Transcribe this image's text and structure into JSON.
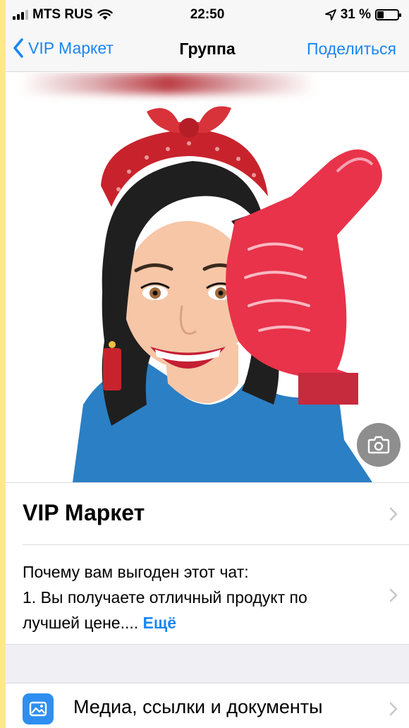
{
  "status_bar": {
    "carrier": "MTS RUS",
    "time": "22:50",
    "battery": "31 %",
    "battery_level": 0.31,
    "signal_bars": 4,
    "signal_bars_on": 3
  },
  "nav": {
    "back_label": "VIP Маркет",
    "title": "Группа",
    "action_label": "Поделиться"
  },
  "group": {
    "name": "VIP Маркет",
    "description_lines": [
      "Почему вам выгоден этот чат:",
      "1. Вы получаете отличный продукт по",
      "лучшей цене...."
    ],
    "more_label": "Ещё"
  },
  "rows": {
    "media_label": "Медиа, ссылки и документы"
  },
  "colors": {
    "accent": "#1a86f2",
    "bandana": "#c8232c",
    "foam_finger": "#e8334a",
    "shirt": "#2b7fc4"
  },
  "icons": [
    "wifi-icon",
    "location-arrow-icon",
    "battery-icon",
    "back-chevron-icon",
    "camera-icon",
    "photo-icon",
    "chevron-right-icon"
  ]
}
